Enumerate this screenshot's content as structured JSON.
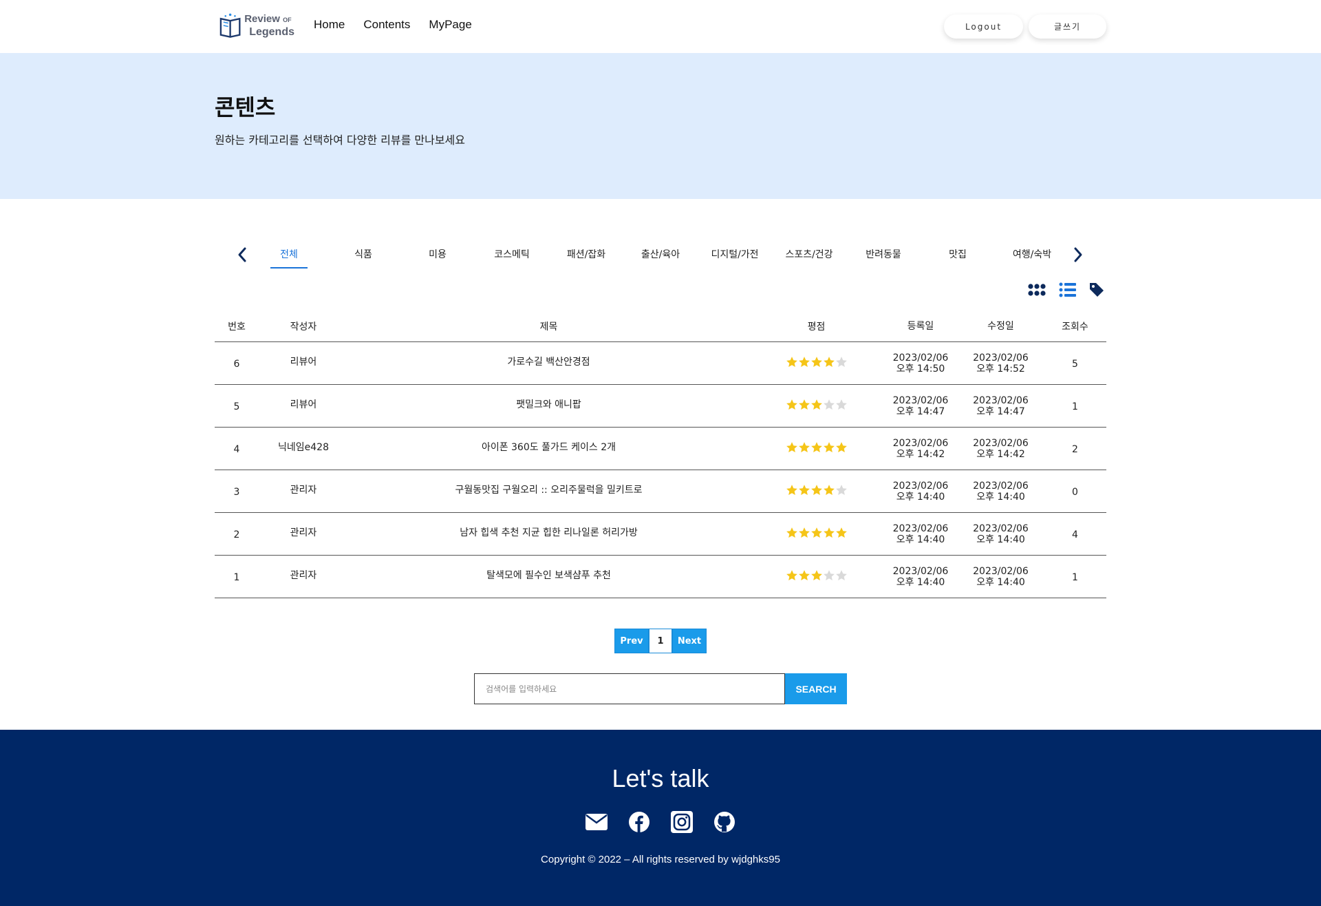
{
  "header": {
    "logo": {
      "line1": "Review",
      "line1_small": "OF",
      "line2": "Legends"
    },
    "nav": [
      "Home",
      "Contents",
      "MyPage"
    ],
    "logout_label": "Logout",
    "write_label": "글쓰기"
  },
  "hero": {
    "title": "콘텐츠",
    "subtitle": "원하는 카테고리를 선택하여 다양한 리뷰를 만나보세요"
  },
  "categories": {
    "active_index": 0,
    "items": [
      "전체",
      "식품",
      "미용",
      "코스메틱",
      "패션/잡화",
      "출산/육아",
      "디지털/가전",
      "스포츠/건강",
      "반려동물",
      "맛집",
      "여행/숙박"
    ]
  },
  "view_icons": [
    "grid-view-icon",
    "list-view-icon",
    "tag-icon"
  ],
  "table": {
    "headers": {
      "no": "번호",
      "author": "작성자",
      "title": "제목",
      "rating": "평점",
      "registered": "등록일",
      "modified": "수정일",
      "views": "조회수"
    },
    "rows": [
      {
        "no": "6",
        "author": "리뷰어",
        "title": "가로수길 백산안경점",
        "rating": 4,
        "reg_date": "2023/02/06",
        "reg_time": "오후 14:50",
        "mod_date": "2023/02/06",
        "mod_time": "오후 14:52",
        "views": "5"
      },
      {
        "no": "5",
        "author": "리뷰어",
        "title": "팻밀크와 애니팝",
        "rating": 3,
        "reg_date": "2023/02/06",
        "reg_time": "오후 14:47",
        "mod_date": "2023/02/06",
        "mod_time": "오후 14:47",
        "views": "1"
      },
      {
        "no": "4",
        "author": "닉네임e428",
        "title": "아이폰 360도 풀가드 케이스 2개",
        "rating": 5,
        "reg_date": "2023/02/06",
        "reg_time": "오후 14:42",
        "mod_date": "2023/02/06",
        "mod_time": "오후 14:42",
        "views": "2"
      },
      {
        "no": "3",
        "author": "관리자",
        "title": "구월동맛집 구월오리 :: 오리주물럭을 밀키트로",
        "rating": 4,
        "reg_date": "2023/02/06",
        "reg_time": "오후 14:40",
        "mod_date": "2023/02/06",
        "mod_time": "오후 14:40",
        "views": "0"
      },
      {
        "no": "2",
        "author": "관리자",
        "title": "남자 힙색 추천 지균 힙한 리나일론 허리가방",
        "rating": 5,
        "reg_date": "2023/02/06",
        "reg_time": "오후 14:40",
        "mod_date": "2023/02/06",
        "mod_time": "오후 14:40",
        "views": "4"
      },
      {
        "no": "1",
        "author": "관리자",
        "title": "탈색모에 필수인 보색샴푸 추천",
        "rating": 3,
        "reg_date": "2023/02/06",
        "reg_time": "오후 14:40",
        "mod_date": "2023/02/06",
        "mod_time": "오후 14:40",
        "views": "1"
      }
    ],
    "max_rating": 5
  },
  "pagination": {
    "prev_label": "Prev",
    "current_page": "1",
    "next_label": "Next"
  },
  "search": {
    "placeholder": "검색어를 입력하세요",
    "button_label": "SEARCH"
  },
  "footer": {
    "heading": "Let's talk",
    "icons": [
      "email-icon",
      "facebook-icon",
      "instagram-icon",
      "github-icon"
    ],
    "copyright": "Copyright © 2022 – All rights reserved by wjdghks95"
  },
  "colors": {
    "accent": "#1a73d9",
    "button_blue": "#1a9bea",
    "hero_bg": "#deecfd",
    "footer_bg": "#002766",
    "star_on": "#f5c518",
    "star_off": "#d9d9d9",
    "icon_navy": "#0d2a5c"
  }
}
